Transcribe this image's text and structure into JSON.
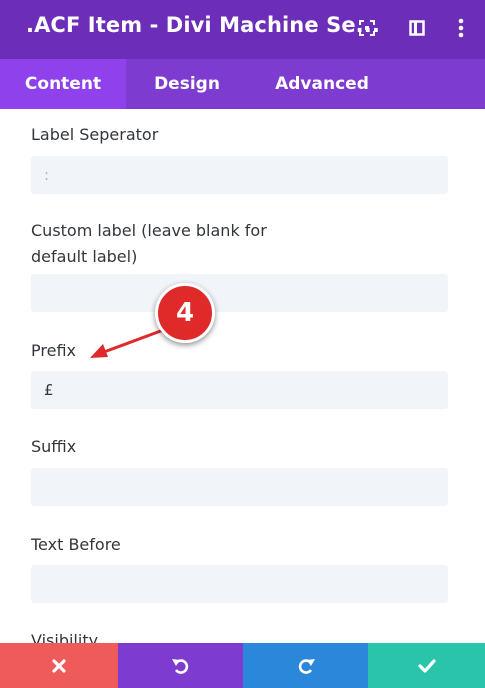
{
  "header": {
    "title": ".ACF Item - Divi Machine Se..."
  },
  "tabs": [
    {
      "label": "Content",
      "active": true
    },
    {
      "label": "Design",
      "active": false
    },
    {
      "label": "Advanced",
      "active": false
    }
  ],
  "fields": {
    "label_separator": {
      "label": "Label Seperator",
      "value": ":"
    },
    "custom_label": {
      "label": "Custom label (leave blank for default label)",
      "value": ""
    },
    "prefix": {
      "label": "Prefix",
      "value": "£"
    },
    "suffix": {
      "label": "Suffix",
      "value": ""
    },
    "text_before": {
      "label": "Text Before",
      "value": ""
    },
    "visibility": {
      "label": "Visibility"
    }
  },
  "annotation": {
    "number": "4"
  },
  "colors": {
    "header": "#6c2eb9",
    "tabs": "#7e3bd0",
    "active_tab": "#8f42ec",
    "cancel": "#ef5a5a",
    "undo": "#7e3bd0",
    "redo": "#2b87da",
    "save": "#29c4a9",
    "annotation": "#e02a2a"
  },
  "icons": {
    "header": [
      "expand-icon",
      "sidebar-toggle-icon",
      "more-icon"
    ],
    "footer": [
      "close-icon",
      "undo-icon",
      "redo-icon",
      "check-icon"
    ]
  }
}
